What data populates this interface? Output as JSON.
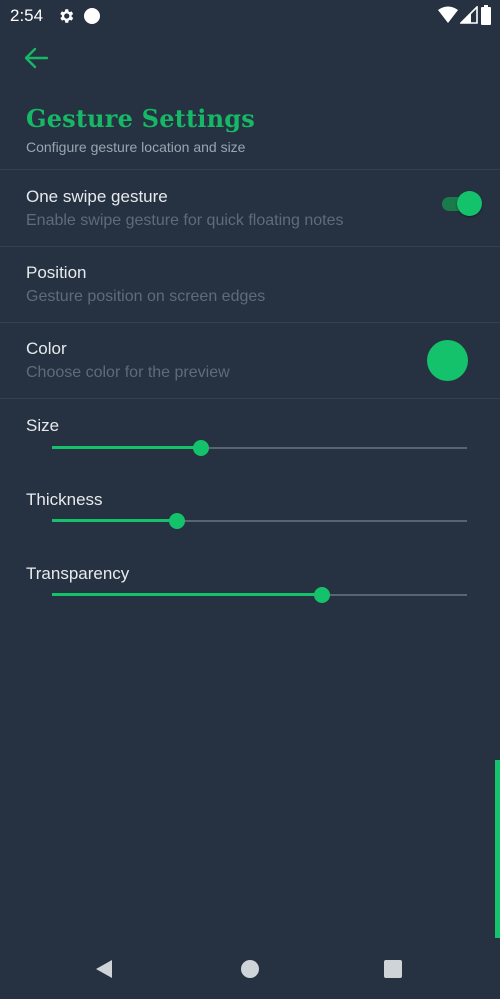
{
  "status_bar": {
    "time": "2:54",
    "icons": [
      "gear-icon",
      "circle-icon",
      "wifi-icon",
      "signal-icon",
      "battery-icon"
    ]
  },
  "header": {
    "back_icon": "arrow-left-icon",
    "title": "Gesture Settings",
    "subtitle": "Configure gesture location and size"
  },
  "preferences": [
    {
      "title": "One swipe gesture",
      "summary": "Enable swipe gesture for quick floating notes",
      "control": "toggle",
      "checked": true
    },
    {
      "title": "Position",
      "summary": "Gesture position on screen edges"
    },
    {
      "title": "Color",
      "summary": "Choose color for the preview",
      "control": "color-swatch",
      "color": "#14c26b"
    }
  ],
  "sliders": [
    {
      "label": "Size",
      "value": 0.36
    },
    {
      "label": "Thickness",
      "value": 0.3
    },
    {
      "label": "Transparency",
      "value": 0.65
    }
  ],
  "nav_bar": {
    "icons": [
      "back-triangle-icon",
      "home-circle-icon",
      "recents-square-icon"
    ]
  },
  "colors": {
    "accent": "#14c26b",
    "background": "#263241",
    "title": "#16b866",
    "secondary_text": "#5f6b78"
  }
}
